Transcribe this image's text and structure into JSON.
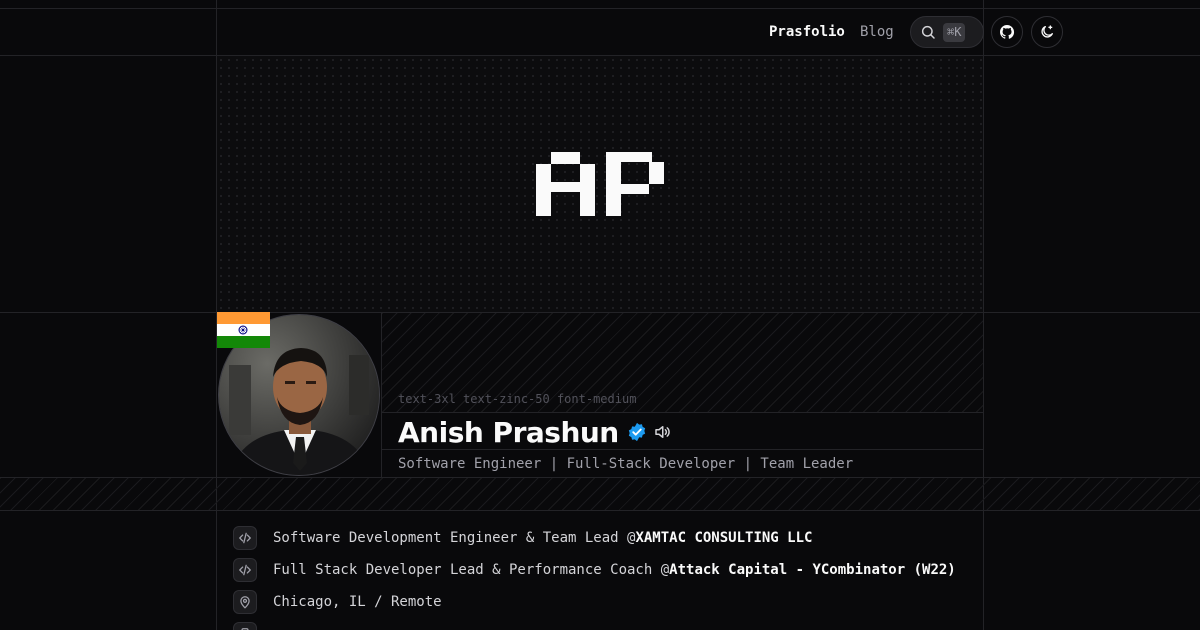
{
  "nav": {
    "links": [
      "Prasfolio",
      "Blog"
    ],
    "search_shortcut": "⌘K"
  },
  "hero": {
    "logo_text": "AP"
  },
  "profile": {
    "class_hint": "text-3xl text-zinc-50 font-medium",
    "name": "Anish Prashun",
    "tagline": "Software Engineer | Full-Stack Developer | Team Leader",
    "flag": "india-flag",
    "verified_icon": "verified-badge-icon",
    "speaker_icon": "speaker-icon"
  },
  "details": [
    {
      "icon": "code-icon",
      "text": "Software Development Engineer & Team Lead @",
      "org": "XAMTAC CONSULTING LLC"
    },
    {
      "icon": "code-icon",
      "text": "Full Stack Developer Lead & Performance Coach @",
      "org": "Attack Capital - YCombinator (W22)"
    },
    {
      "icon": "map-pin-icon",
      "text": "Chicago, IL / Remote",
      "org": ""
    }
  ],
  "colors": {
    "background": "#09090b",
    "border": "#232327",
    "verified": "#1d9bf0",
    "text_primary": "#fafafa",
    "text_muted": "#a1a1aa"
  }
}
